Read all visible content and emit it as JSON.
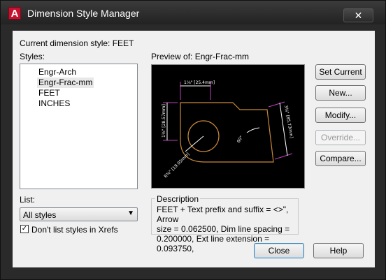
{
  "window": {
    "title": "Dimension Style Manager",
    "app_icon_letter": "A",
    "close_glyph": "✕"
  },
  "current_style": {
    "label": "Current dimension style: FEET"
  },
  "styles": {
    "label": "Styles:",
    "items": [
      {
        "label": "Engr-Arch",
        "selected": false
      },
      {
        "label": "Engr-Frac-mm",
        "selected": true
      },
      {
        "label": "FEET",
        "selected": false
      },
      {
        "label": "INCHES",
        "selected": false
      }
    ]
  },
  "list": {
    "label": "List:",
    "value": "All styles",
    "arrow": "▼"
  },
  "xref_checkbox": {
    "label": "Don't list styles in Xrefs",
    "checked": true,
    "mark": "✓"
  },
  "preview": {
    "label": "Preview of: Engr-Frac-mm",
    "dim_texts": {
      "top": "1⅛\" [25.4mm]",
      "left": "1⅛\" [28.57mm]",
      "right": "3⅜\" [85.73mm]",
      "angle": "60°",
      "radius": "R¾\" [19.05mm]"
    },
    "colors": {
      "outline": "#c8883a",
      "dimension": "#ffffff",
      "extension": "#c040c0"
    }
  },
  "description": {
    "title": "Description",
    "lines": [
      "FEET + Text prefix and suffix = <>\", Arrow",
      "size = 0.062500, Dim line spacing =",
      "0.200000, Ext line extension = 0.093750,"
    ]
  },
  "buttons": {
    "set_current": "Set Current",
    "new": "New...",
    "modify": "Modify...",
    "override": "Override...",
    "compare": "Compare...",
    "close": "Close",
    "help": "Help"
  }
}
